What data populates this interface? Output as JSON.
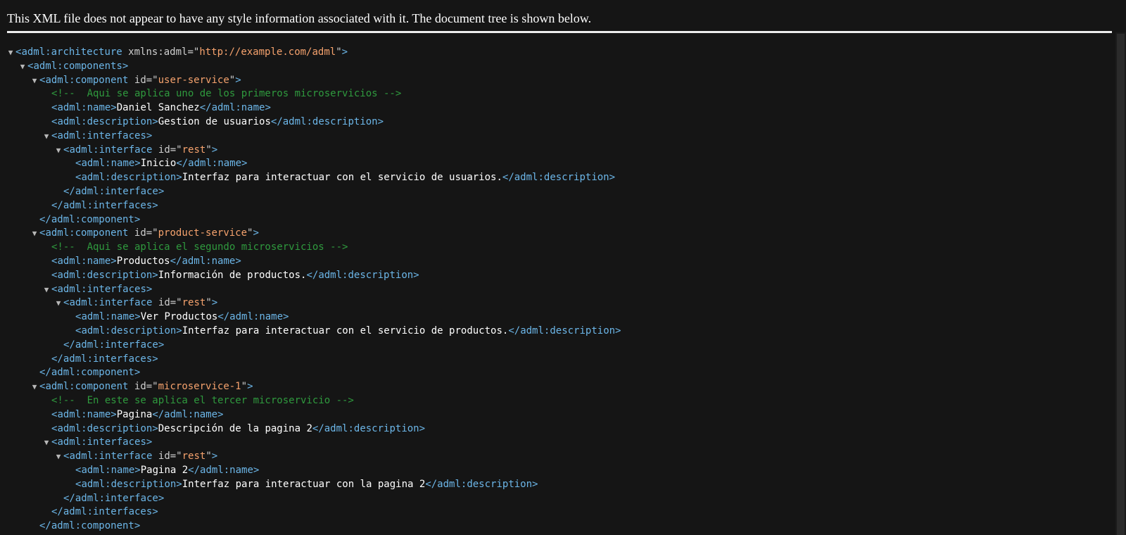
{
  "header": {
    "notice": "This XML file does not appear to have any style information associated with it. The document tree is shown below."
  },
  "tree": {
    "lines": [
      {
        "depth": 0,
        "arrow": true,
        "kind": "open",
        "tag": "adml:architecture",
        "attr": "xmlns:adml",
        "value": "http://example.com/adml"
      },
      {
        "depth": 1,
        "arrow": true,
        "kind": "open",
        "tag": "adml:components"
      },
      {
        "depth": 2,
        "arrow": true,
        "kind": "open",
        "tag": "adml:component",
        "attr": "id",
        "value": "user-service"
      },
      {
        "depth": 3,
        "arrow": false,
        "kind": "comment",
        "text": "<!--  Aqui se aplica uno de los primeros microservicios -->"
      },
      {
        "depth": 3,
        "arrow": false,
        "kind": "element",
        "tag": "adml:name",
        "text": "Daniel Sanchez"
      },
      {
        "depth": 3,
        "arrow": false,
        "kind": "element",
        "tag": "adml:description",
        "text": "Gestion de usuarios"
      },
      {
        "depth": 3,
        "arrow": true,
        "kind": "open",
        "tag": "adml:interfaces"
      },
      {
        "depth": 4,
        "arrow": true,
        "kind": "open",
        "tag": "adml:interface",
        "attr": "id",
        "value": "rest"
      },
      {
        "depth": 5,
        "arrow": false,
        "kind": "element",
        "tag": "adml:name",
        "text": "Inicio"
      },
      {
        "depth": 5,
        "arrow": false,
        "kind": "element",
        "tag": "adml:description",
        "text": "Interfaz para interactuar con el servicio de usuarios."
      },
      {
        "depth": 4,
        "arrow": false,
        "kind": "close",
        "tag": "adml:interface"
      },
      {
        "depth": 3,
        "arrow": false,
        "kind": "close",
        "tag": "adml:interfaces"
      },
      {
        "depth": 2,
        "arrow": false,
        "kind": "close",
        "tag": "adml:component"
      },
      {
        "depth": 2,
        "arrow": true,
        "kind": "open",
        "tag": "adml:component",
        "attr": "id",
        "value": "product-service"
      },
      {
        "depth": 3,
        "arrow": false,
        "kind": "comment",
        "text": "<!--  Aqui se aplica el segundo microservicios -->"
      },
      {
        "depth": 3,
        "arrow": false,
        "kind": "element",
        "tag": "adml:name",
        "text": "Productos"
      },
      {
        "depth": 3,
        "arrow": false,
        "kind": "element",
        "tag": "adml:description",
        "text": "Información de productos."
      },
      {
        "depth": 3,
        "arrow": true,
        "kind": "open",
        "tag": "adml:interfaces"
      },
      {
        "depth": 4,
        "arrow": true,
        "kind": "open",
        "tag": "adml:interface",
        "attr": "id",
        "value": "rest"
      },
      {
        "depth": 5,
        "arrow": false,
        "kind": "element",
        "tag": "adml:name",
        "text": "Ver Productos"
      },
      {
        "depth": 5,
        "arrow": false,
        "kind": "element",
        "tag": "adml:description",
        "text": "Interfaz para interactuar con el servicio de productos."
      },
      {
        "depth": 4,
        "arrow": false,
        "kind": "close",
        "tag": "adml:interface"
      },
      {
        "depth": 3,
        "arrow": false,
        "kind": "close",
        "tag": "adml:interfaces"
      },
      {
        "depth": 2,
        "arrow": false,
        "kind": "close",
        "tag": "adml:component"
      },
      {
        "depth": 2,
        "arrow": true,
        "kind": "open",
        "tag": "adml:component",
        "attr": "id",
        "value": "microservice-1"
      },
      {
        "depth": 3,
        "arrow": false,
        "kind": "comment",
        "text": "<!--  En este se aplica el tercer microservicio -->"
      },
      {
        "depth": 3,
        "arrow": false,
        "kind": "element",
        "tag": "adml:name",
        "text": "Pagina"
      },
      {
        "depth": 3,
        "arrow": false,
        "kind": "element",
        "tag": "adml:description",
        "text": "Descripción de la pagina 2"
      },
      {
        "depth": 3,
        "arrow": true,
        "kind": "open",
        "tag": "adml:interfaces"
      },
      {
        "depth": 4,
        "arrow": true,
        "kind": "open",
        "tag": "adml:interface",
        "attr": "id",
        "value": "rest"
      },
      {
        "depth": 5,
        "arrow": false,
        "kind": "element",
        "tag": "adml:name",
        "text": "Pagina 2"
      },
      {
        "depth": 5,
        "arrow": false,
        "kind": "element",
        "tag": "adml:description",
        "text": "Interfaz para interactuar con la pagina 2"
      },
      {
        "depth": 4,
        "arrow": false,
        "kind": "close",
        "tag": "adml:interface"
      },
      {
        "depth": 3,
        "arrow": false,
        "kind": "close",
        "tag": "adml:interfaces"
      },
      {
        "depth": 2,
        "arrow": false,
        "kind": "close",
        "tag": "adml:component"
      }
    ]
  },
  "colors": {
    "background": "#151515",
    "tag": "#6cb6e8",
    "attribute_value": "#f5a26d",
    "comment": "#2f9a3e",
    "text": "#ffffff"
  },
  "icons": {
    "collapse": "triangle-down-icon"
  }
}
